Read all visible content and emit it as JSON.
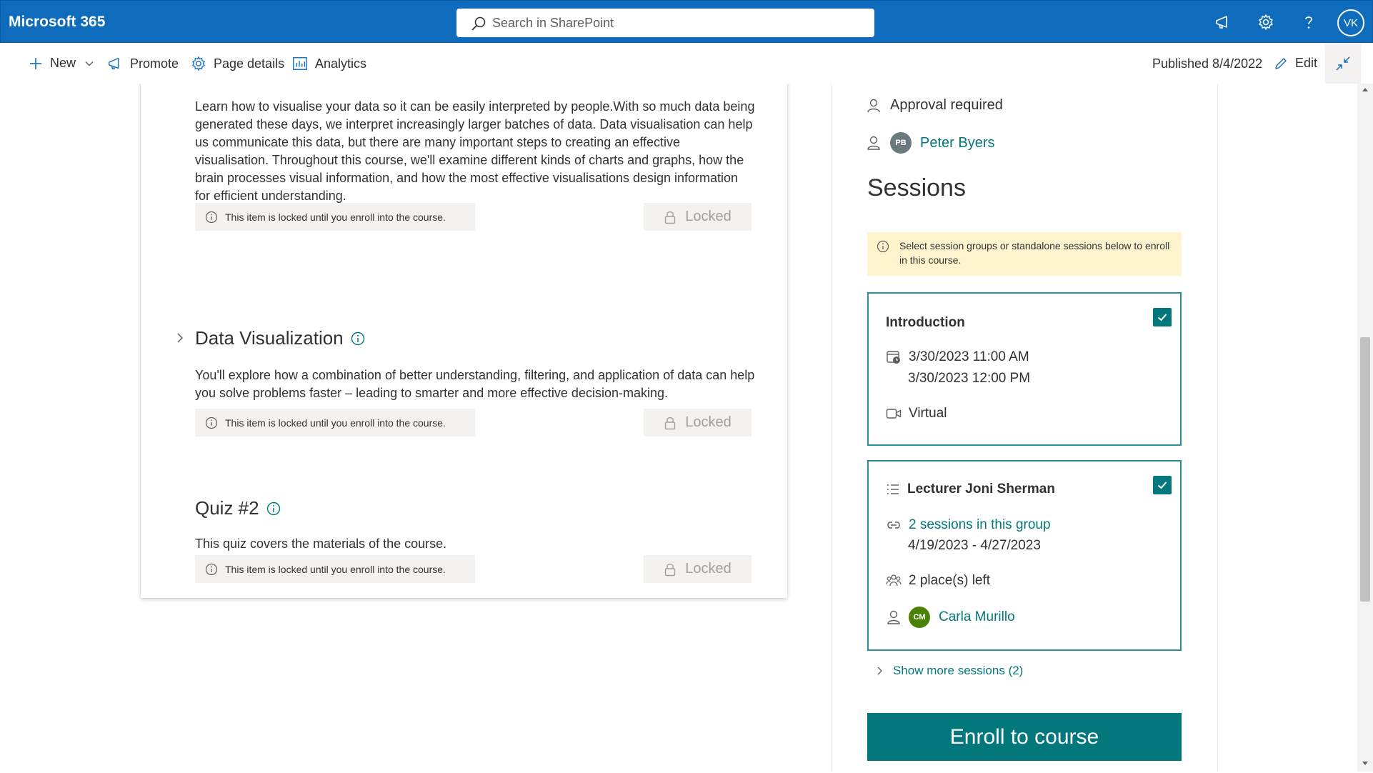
{
  "suitebar": {
    "title": "Microsoft 365",
    "search_placeholder": "Search in SharePoint",
    "user_initials": "VK",
    "color": "#0f6cbd"
  },
  "commandbar": {
    "new_label": "New",
    "promote_label": "Promote",
    "page_details_label": "Page details",
    "analytics_label": "Analytics",
    "published": "Published 8/4/2022",
    "edit_label": "Edit"
  },
  "course": {
    "items": [
      {
        "description": "Learn how to visualise your data so it can be easily interpreted by people.With so much data being generated these days, we interpret increasingly larger batches of data. Data visualisation can help us communicate this data, but there are many important steps to creating an effective visualisation. Throughout this course, we'll examine different kinds of charts and graphs, how the brain processes visual information, and how the most effective visualisations design information for efficient understanding.",
        "lock_note": "This item is locked until you enroll into the course.",
        "locked_label": "Locked"
      },
      {
        "title": "Data Visualization",
        "description": "You'll explore how a combination of better understanding, filtering, and application of data can help you solve problems faster – leading to smarter and more effective decision-making.",
        "lock_note": "This item is locked until you enroll into the course.",
        "locked_label": "Locked"
      },
      {
        "title": "Quiz #2",
        "description": "This quiz covers the materials of the course.",
        "lock_note": "This item is locked until you enroll into the course.",
        "locked_label": "Locked"
      }
    ]
  },
  "panel": {
    "approval": "Approval required",
    "owner_initials": "PB",
    "owner_name": "Peter Byers",
    "sessions_title": "Sessions",
    "notice": "Select session groups or standalone sessions below to enroll in this course.",
    "sessions": [
      {
        "title": "Introduction",
        "start": "3/30/2023 11:00 AM",
        "end": "3/30/2023 12:00 PM",
        "location": "Virtual",
        "checked": true
      },
      {
        "title": "Lecturer Joni Sherman",
        "group_link": "2 sessions in this group",
        "dates": "4/19/2023 - 4/27/2023",
        "places": "2 place(s) left",
        "lecturer_initials": "CM",
        "lecturer_name": "Carla Murillo",
        "checked": true
      }
    ],
    "show_more": "Show more sessions (2)",
    "enroll_label": "Enroll to course",
    "accent": "#03787c"
  }
}
